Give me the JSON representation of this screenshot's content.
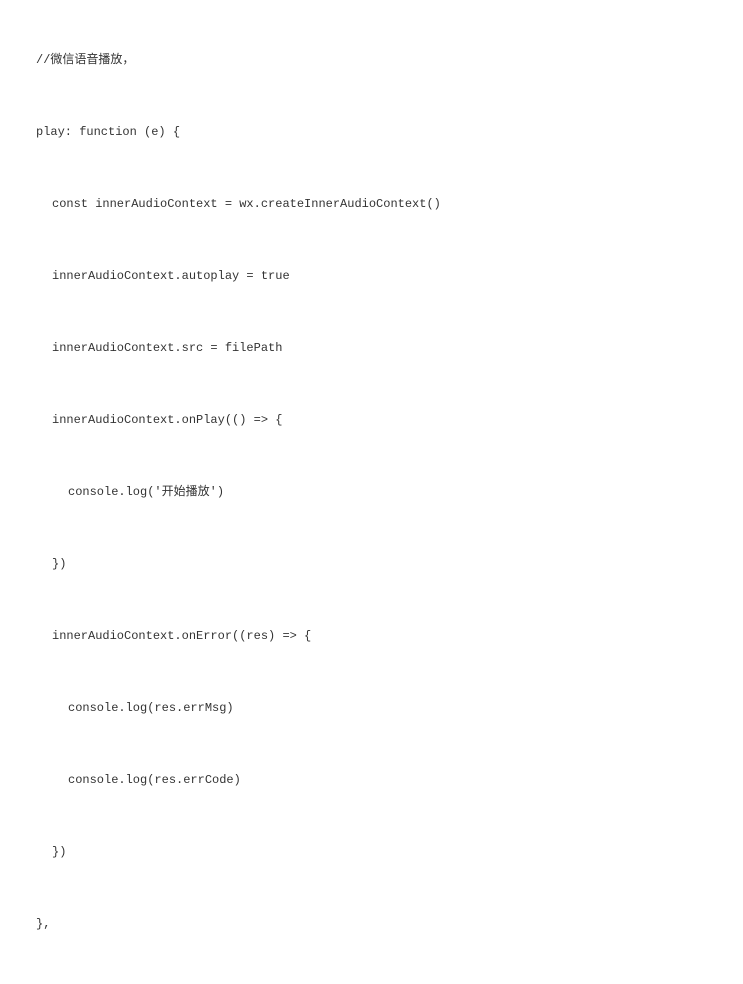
{
  "code": {
    "line1": "//微信语音播放，",
    "line2": "play: function (e) {",
    "line3": "const innerAudioContext = wx.createInnerAudioContext()",
    "line4": "innerAudioContext.autoplay = true",
    "line5": "innerAudioContext.src = filePath",
    "line6": "innerAudioContext.onPlay(() => {",
    "line7": "console.log('开始播放')",
    "line8": "})",
    "line9": "innerAudioContext.onError((res) => {",
    "line10": "console.log(res.errMsg)",
    "line11": "console.log(res.errCode)",
    "line12": "})",
    "line13": "},"
  }
}
